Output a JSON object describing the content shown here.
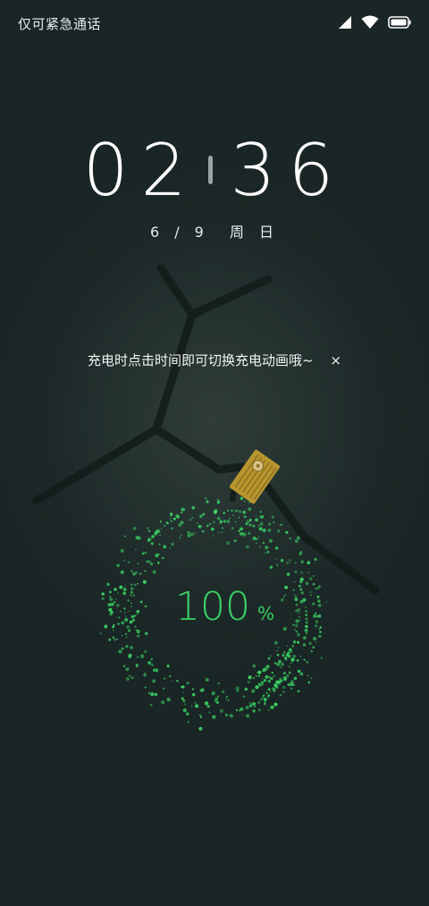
{
  "status_bar": {
    "carrier_text": "仅可紧急通话",
    "icons": [
      "signal-icon",
      "wifi-icon",
      "battery-icon"
    ]
  },
  "clock": {
    "hours": "02",
    "minutes": "36"
  },
  "date": {
    "month_day": "6 / 9",
    "weekday": "周 日"
  },
  "tip": {
    "text": "充电时点击时间即可切换充电动画哦~",
    "close_label": "×"
  },
  "charging": {
    "level": "100",
    "unit": "%",
    "level_fraction": 1.0,
    "ring_color": "#39d163"
  },
  "colors": {
    "background": "#1c2827",
    "accent": "#39d163",
    "connector": "#b8962e"
  }
}
